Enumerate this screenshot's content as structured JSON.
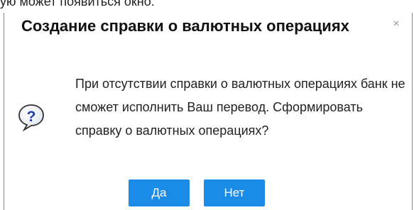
{
  "background_text": "ую может появиться окно:",
  "dialog": {
    "title": "Создание справки о валютных операциях",
    "close_symbol": "×",
    "icon": "question-icon",
    "message": "При отсутствии справки о валютных операциях банк не сможет исполнить Ваш перевод. Сформировать справку о валютных операциях?",
    "buttons": {
      "yes_label": "Да",
      "no_label": "Нет"
    },
    "colors": {
      "button_bg": "#1a8be6",
      "button_text": "#ffffff",
      "icon_blue": "#1b3fa8"
    }
  }
}
